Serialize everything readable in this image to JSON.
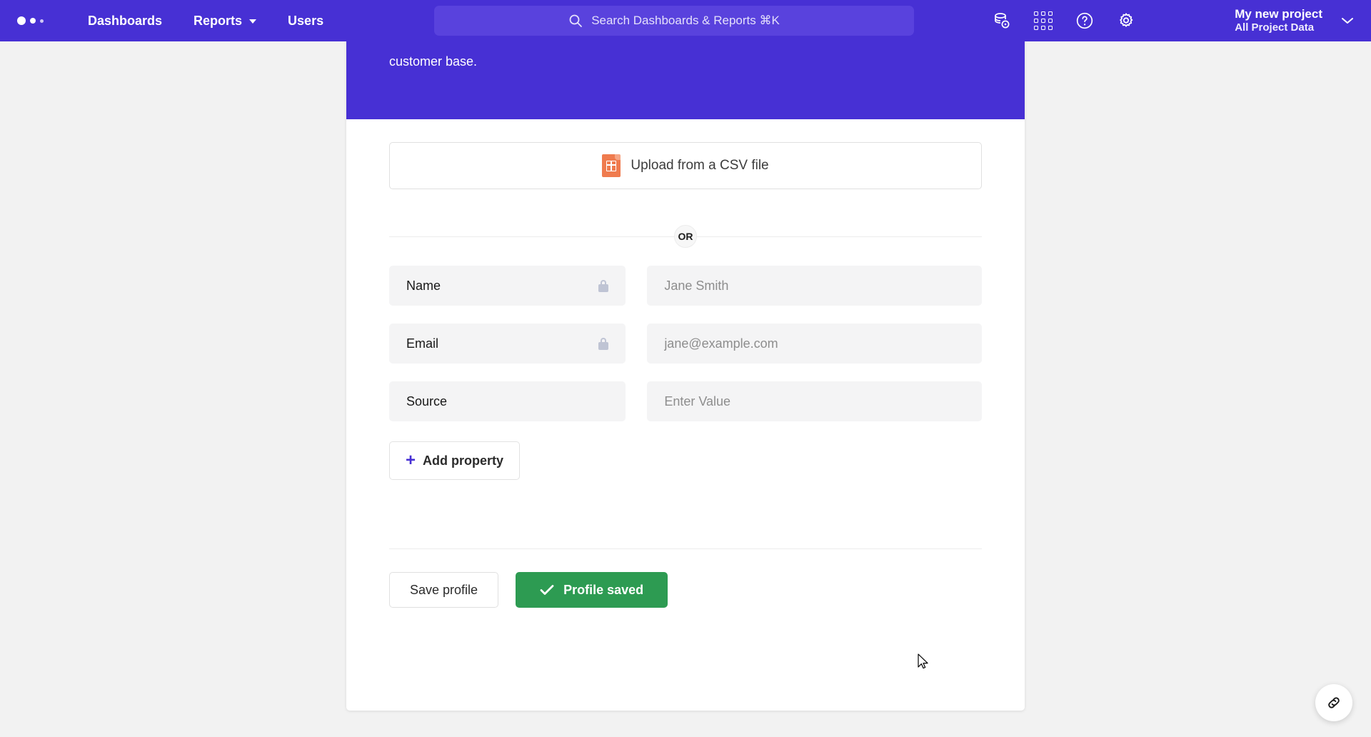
{
  "header": {
    "logo_icon": "three-dots-logo",
    "nav": [
      {
        "label": "Dashboards",
        "has_caret": false
      },
      {
        "label": "Reports",
        "has_caret": true
      },
      {
        "label": "Users",
        "has_caret": false
      }
    ],
    "search": {
      "placeholder": "Search Dashboards & Reports ⌘K",
      "icon": "search-icon"
    },
    "icons": [
      {
        "name": "database-settings-icon"
      },
      {
        "name": "apps-grid-icon"
      },
      {
        "name": "help-circle-icon"
      },
      {
        "name": "gear-icon"
      }
    ],
    "project": {
      "name": "My new project",
      "subtitle": "All Project Data",
      "caret_icon": "chevron-down-icon"
    },
    "background_color": "#4730d4"
  },
  "banner": {
    "text": "customer base."
  },
  "upload": {
    "label": "Upload from a CSV file",
    "icon": "csv-file-icon"
  },
  "divider": {
    "or_label": "OR"
  },
  "properties": [
    {
      "key": "Name",
      "locked": true,
      "value": "",
      "placeholder": "Jane Smith"
    },
    {
      "key": "Email",
      "locked": true,
      "value": "",
      "placeholder": "jane@example.com"
    },
    {
      "key": "Source",
      "locked": false,
      "value": "",
      "placeholder": "Enter Value"
    }
  ],
  "add_property": {
    "label": "Add property",
    "plus": "+",
    "accent_color": "#4730d4"
  },
  "footer": {
    "save_label": "Save profile",
    "saved_label": "Profile saved",
    "saved_icon": "check-icon",
    "success_color": "#2d9b52"
  },
  "fab": {
    "icon": "link-chain-icon"
  }
}
